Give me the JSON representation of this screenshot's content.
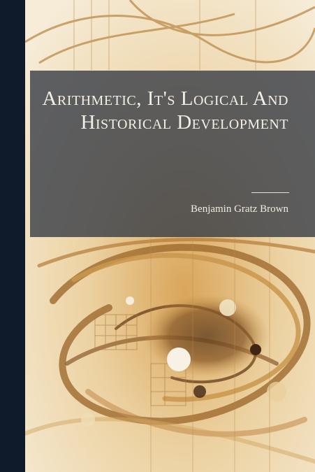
{
  "book": {
    "title": "Arithmetic, It's Logical And Historical Development",
    "author": "Benjamin Gratz Brown"
  },
  "colors": {
    "spine": "#0f1a2b",
    "title_band": "#3a3f48",
    "title_text": "#f3efe6",
    "artwork_gold": "#c9964b",
    "artwork_cream": "#f3e5c8"
  },
  "artwork": {
    "icon": "abstract-gold-swirl-illustration-icon"
  }
}
